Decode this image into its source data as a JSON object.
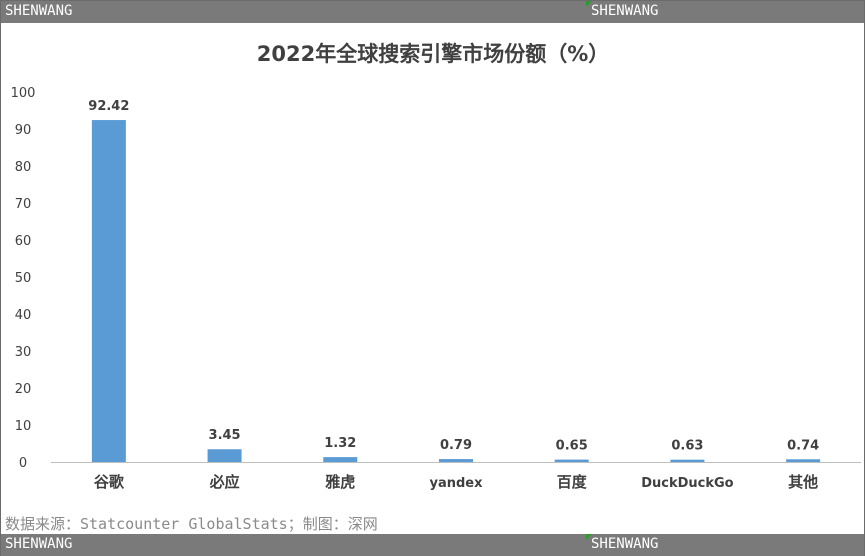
{
  "watermark": {
    "top_left": "SHENWANG",
    "top_right": "SHENWANG",
    "bottom_left": "SHENWANG",
    "bottom_right": "SHENWANG"
  },
  "colors": {
    "bar": "#5b9bd5",
    "axis_text": "#404040",
    "watermark_bg": "#7a7a7a",
    "tick_mark": "#2e9a2e"
  },
  "source_note": "数据来源：Statcounter GlobalStats；制图：深网",
  "chart_data": {
    "type": "bar",
    "title": "2022年全球搜索引擎市场份额（%）",
    "categories": [
      "谷歌",
      "必应",
      "雅虎",
      "yandex",
      "百度",
      "DuckDuckGo",
      "其他"
    ],
    "values": [
      92.42,
      3.45,
      1.32,
      0.79,
      0.65,
      0.63,
      0.74
    ],
    "value_labels": [
      "92.42",
      "3.45",
      "1.32",
      "0.79",
      "0.65",
      "0.63",
      "0.74"
    ],
    "yticks": [
      "0",
      "10",
      "20",
      "30",
      "40",
      "50",
      "60",
      "70",
      "80",
      "90",
      "100"
    ],
    "ylim": [
      0,
      100
    ],
    "grid": false,
    "legend": "none"
  }
}
